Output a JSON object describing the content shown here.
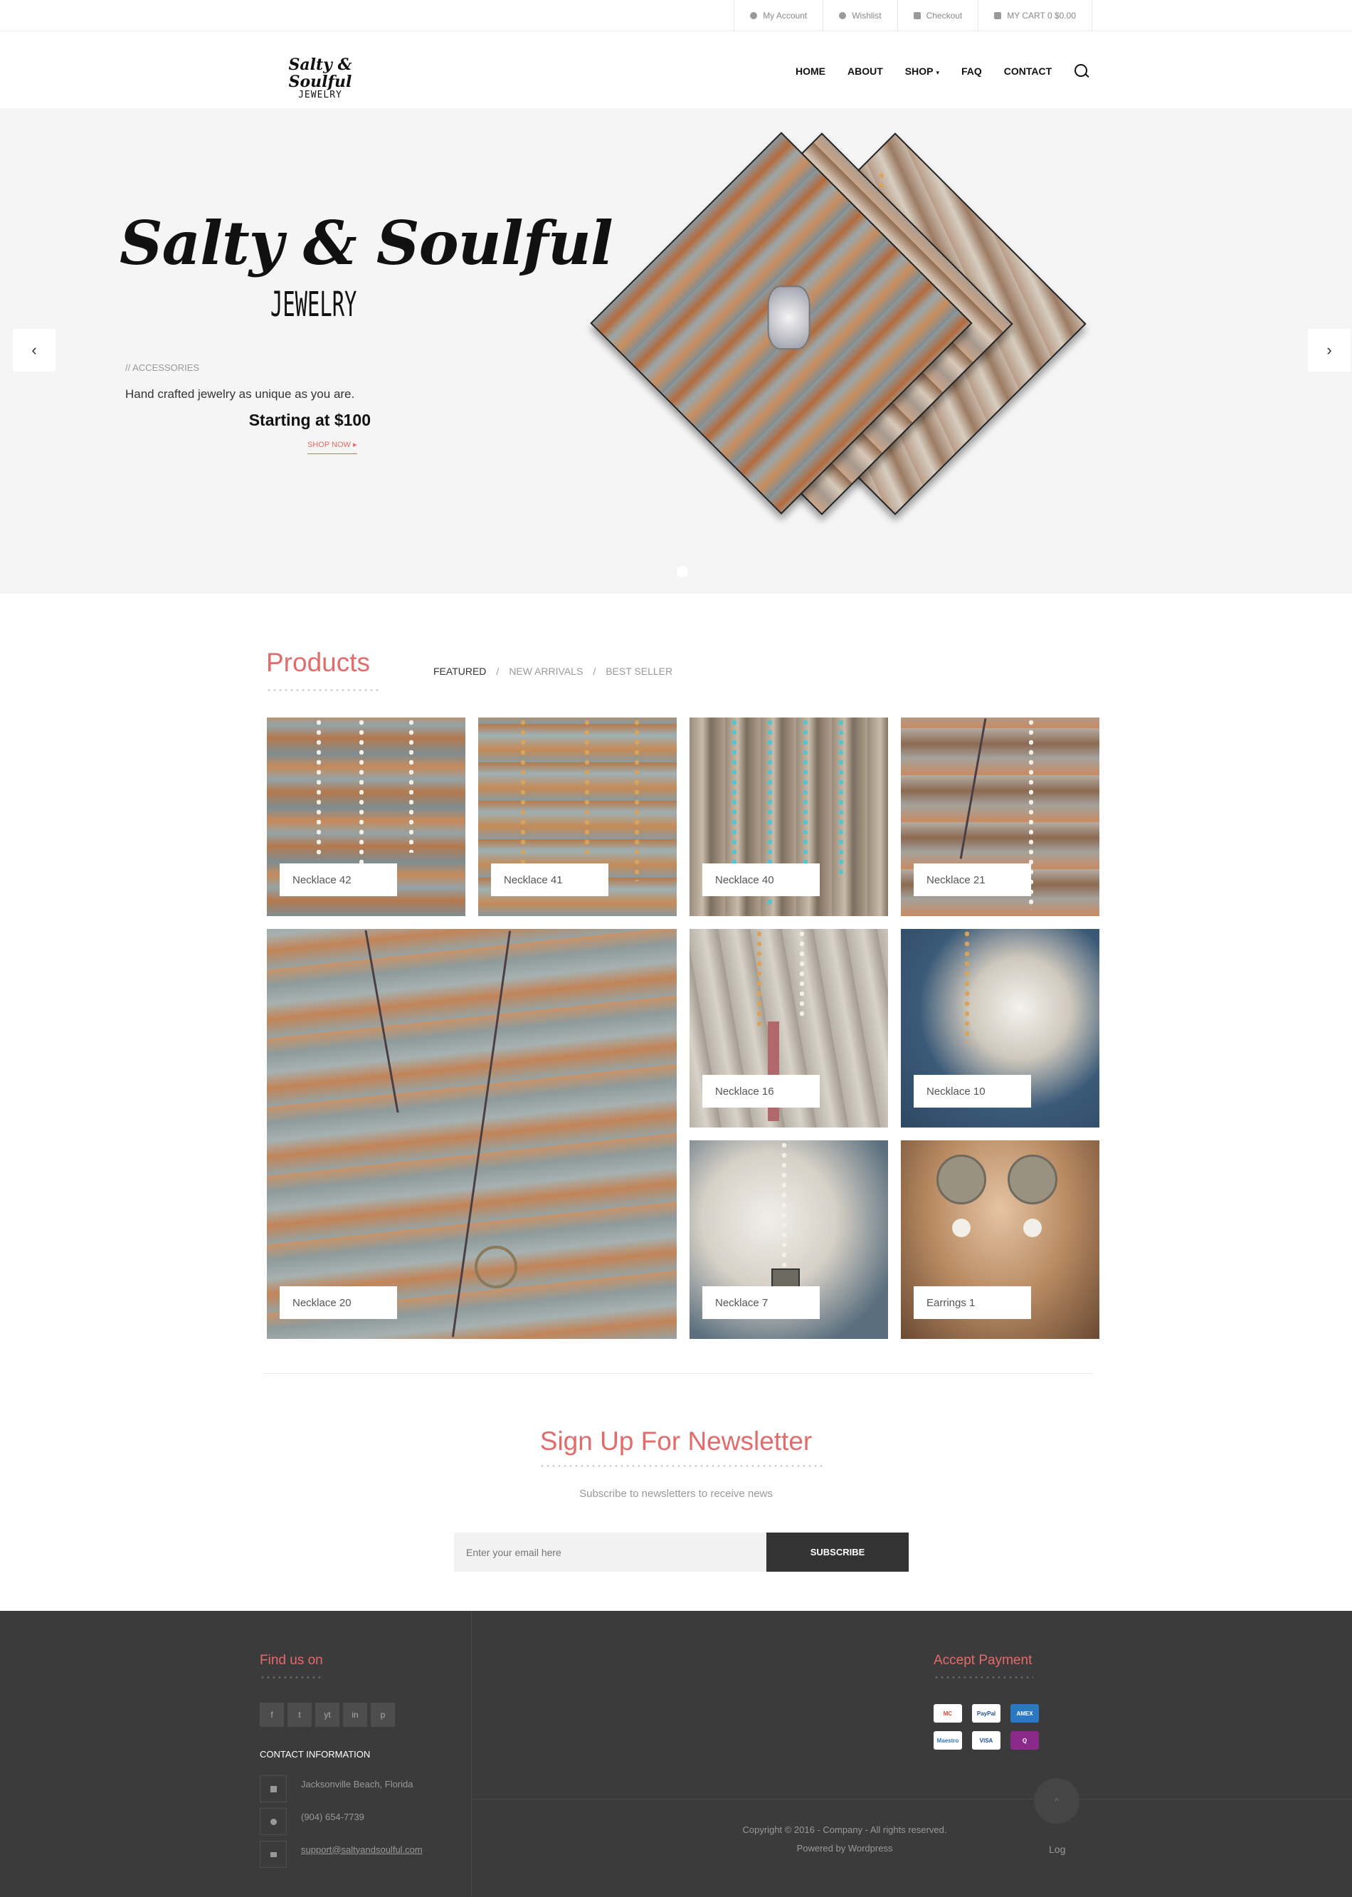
{
  "topbar": {
    "my_account": "My Account",
    "wishlist": "Wishlist",
    "checkout": "Checkout",
    "cart": "MY CART 0 $0.00"
  },
  "logo": {
    "line1": "Salty & Soulful",
    "line2": "JEWELRY"
  },
  "nav": {
    "home": "HOME",
    "about": "ABOUT",
    "shop": "SHOP",
    "faq": "FAQ",
    "contact": "CONTACT"
  },
  "hero": {
    "title1": "Salty & Soulful",
    "title2": "JEWELRY",
    "category": "// ACCESSORIES",
    "tagline": "Hand crafted jewelry as unique as you are.",
    "price": "Starting at $100",
    "cta": "SHOP NOW",
    "prev": "‹",
    "next": "›"
  },
  "products": {
    "title": "Products",
    "tabs": [
      "FEATURED",
      "NEW ARRIVALS",
      "BEST SELLER"
    ],
    "separator": "/",
    "items": [
      "Necklace 42",
      "Necklace 41",
      "Necklace 40",
      "Necklace 21",
      "Necklace 20",
      "Necklace 16",
      "Necklace 10",
      "Necklace 7",
      "Earrings 1"
    ]
  },
  "newsletter": {
    "title": "Sign Up For Newsletter",
    "subtitle": "Subscribe to newsletters to receive news",
    "placeholder": "Enter your email here",
    "button": "SUBSCRIBE"
  },
  "footer": {
    "find_us": "Find us on",
    "social": [
      "f",
      "t",
      "yt",
      "in",
      "p"
    ],
    "contact_head": "CONTACT INFORMATION",
    "address": "Jacksonville Beach, Florida",
    "phone": "(904) 654-7739",
    "email": "support@saltyandsoulful.com",
    "accept_payment": "Accept Payment",
    "payments": [
      "MC",
      "PayPal",
      "AMEX",
      "Maestro",
      "VISA",
      "Q"
    ],
    "copyright": "Copyright © 2016 - Company - All rights reserved.",
    "powered": "Powered by Wordpress",
    "log": "Log",
    "to_top": "^"
  },
  "colors": {
    "accent": "#e26b6b",
    "footer_bg": "#3b3b3c",
    "hero_bg": "#f5f5f5"
  }
}
